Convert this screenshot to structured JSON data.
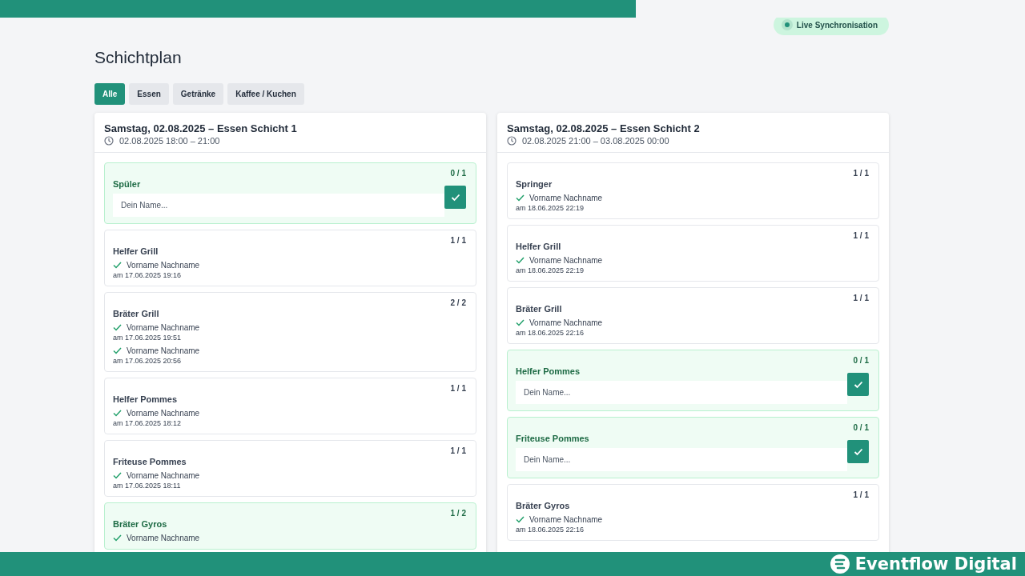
{
  "sync_badge": {
    "label": "Live Synchronisation",
    "live": true
  },
  "title": "Schichtplan",
  "tabs": [
    {
      "label": "Alle",
      "selected": true
    },
    {
      "label": "Essen",
      "selected": false
    },
    {
      "label": "Getränke",
      "selected": false
    },
    {
      "label": "Kaffee / Kuchen",
      "selected": false
    }
  ],
  "shifts": [
    {
      "title": "Samstag, 02.08.2025 – Essen Schicht 1",
      "time": "02.08.2025 18:00 – 21:00",
      "slots": [
        {
          "role": "Spüler",
          "count": "0 / 1",
          "open": true,
          "placeholder": "Dein Name..."
        },
        {
          "role": "Helfer Grill",
          "count": "1 / 1",
          "open": false,
          "entries": [
            {
              "name": "Vorname Nachname",
              "date": "am 17.06.2025 19:16"
            }
          ]
        },
        {
          "role": "Bräter Grill",
          "count": "2 / 2",
          "open": false,
          "entries": [
            {
              "name": "Vorname Nachname",
              "date": "am 17.06.2025 19:51"
            },
            {
              "name": "Vorname Nachname",
              "date": "am 17.06.2025 20:56"
            }
          ]
        },
        {
          "role": "Helfer Pommes",
          "count": "1 / 1",
          "open": false,
          "entries": [
            {
              "name": "Vorname Nachname",
              "date": "am 17.06.2025 18:12"
            }
          ]
        },
        {
          "role": "Friteuse Pommes",
          "count": "1 / 1",
          "open": false,
          "entries": [
            {
              "name": "Vorname Nachname",
              "date": "am 17.06.2025 18:11"
            }
          ]
        },
        {
          "role": "Bräter Gyros",
          "count": "1 / 2",
          "open": true,
          "entries": [
            {
              "name": "Vorname Nachname"
            }
          ]
        }
      ]
    },
    {
      "title": "Samstag, 02.08.2025 – Essen Schicht 2",
      "time": "02.08.2025 21:00 – 03.08.2025 00:00",
      "slots": [
        {
          "role": "Springer",
          "count": "1 / 1",
          "open": false,
          "entries": [
            {
              "name": "Vorname Nachname",
              "date": "am 18.06.2025 22:19"
            }
          ]
        },
        {
          "role": "Helfer Grill",
          "count": "1 / 1",
          "open": false,
          "entries": [
            {
              "name": "Vorname Nachname",
              "date": "am 18.06.2025 22:19"
            }
          ]
        },
        {
          "role": "Bräter Grill",
          "count": "1 / 1",
          "open": false,
          "entries": [
            {
              "name": "Vorname Nachname",
              "date": "am 18.06.2025 22:16"
            }
          ]
        },
        {
          "role": "Helfer Pommes",
          "count": "0 / 1",
          "open": true,
          "placeholder": "Dein Name..."
        },
        {
          "role": "Friteuse Pommes",
          "count": "0 / 1",
          "open": true,
          "placeholder": "Dein Name..."
        },
        {
          "role": "Bräter Gyros",
          "count": "1 / 1",
          "open": false,
          "entries": [
            {
              "name": "Vorname Nachname",
              "date": "am 18.06.2025 22:16"
            }
          ]
        }
      ]
    }
  ],
  "brand": {
    "name": "Eventflow Digital"
  }
}
